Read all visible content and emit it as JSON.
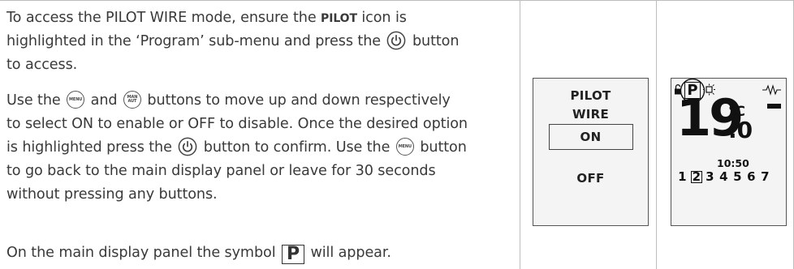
{
  "paragraph1": {
    "line1_before": "To access the PILOT WIRE mode, ensure the ",
    "line1_bold": "PILOT",
    "line1_after": " icon is",
    "line2_before": "highlighted in the ‘Program’ sub-menu and press the ",
    "line2_after": " button",
    "line3": "to access."
  },
  "paragraph2": {
    "line1_a": "Use the ",
    "line1_b": " and ",
    "line1_c": " buttons to move up and down respectively",
    "line2": "to select ON to enable or OFF to disable. Once the desired option",
    "line3_a": "is highlighted press the ",
    "line3_b": " button to confirm. Use the ",
    "line3_c": " button",
    "line4": "to go back to the main display panel or leave for 30 seconds",
    "line5": "without pressing any buttons."
  },
  "paragraph3": {
    "before": "On the main display panel the symbol ",
    "after": " will appear."
  },
  "icons": {
    "menu_text": "MENU",
    "man_text": "MAN",
    "aut_text": "AUT",
    "p_symbol": "P",
    "power": "power-icon"
  },
  "screen_pilot": {
    "title_line1": "PILOT",
    "title_line2": "WIRE",
    "option_on": "ON",
    "option_off": "OFF"
  },
  "screen_main": {
    "p_symbol": "P",
    "temp_whole": "19",
    "temp_unit": "°C",
    "temp_decimal": ".0",
    "clock": "10:50",
    "days": [
      "1",
      "2",
      "3",
      "4",
      "5",
      "6",
      "7"
    ],
    "selected_day": "2"
  }
}
